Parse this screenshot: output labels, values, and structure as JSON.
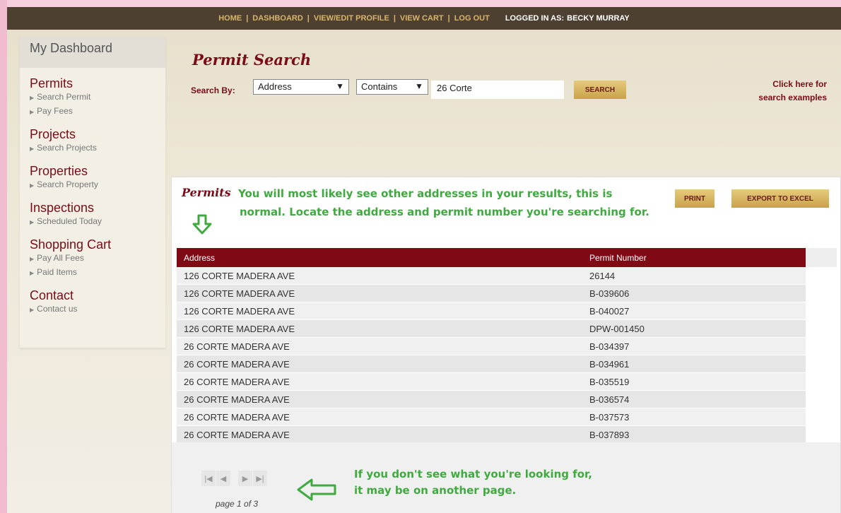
{
  "topnav": {
    "items": [
      "HOME",
      "DASHBOARD",
      "VIEW/EDIT PROFILE",
      "VIEW CART",
      "LOG OUT"
    ],
    "separator": "|",
    "logged_in_label": "LOGGED IN AS:",
    "user": "BECKY MURRAY"
  },
  "sidebar": {
    "heading": "My Dashboard",
    "sections": [
      {
        "title": "Permits",
        "links": [
          "Search Permit",
          "Pay Fees"
        ]
      },
      {
        "title": "Projects",
        "links": [
          "Search Projects"
        ]
      },
      {
        "title": "Properties",
        "links": [
          "Search Property"
        ]
      },
      {
        "title": "Inspections",
        "links": [
          "Scheduled Today"
        ]
      },
      {
        "title": "Shopping Cart",
        "links": [
          "Pay All Fees",
          "Paid Items"
        ]
      },
      {
        "title": "Contact",
        "links": [
          "Contact us"
        ]
      }
    ]
  },
  "search": {
    "title": "Permit Search",
    "label": "Search By:",
    "field": "Address",
    "operator": "Contains",
    "value": "26 Corte",
    "button": "SEARCH",
    "examples_line1": "Click here for",
    "examples_line2": "search examples"
  },
  "results": {
    "title": "Permits",
    "note_line1": "You will most likely see other addresses in your results, this is",
    "note_line2": "normal. Locate the address and permit number you're searching for.",
    "print_button": "PRINT",
    "export_button": "EXPORT TO EXCEL",
    "columns": [
      "Address",
      "Permit Number"
    ],
    "rows": [
      [
        "126 CORTE MADERA AVE",
        "26144"
      ],
      [
        "126 CORTE MADERA AVE",
        "B-039606"
      ],
      [
        "126 CORTE MADERA AVE",
        "B-040027"
      ],
      [
        "126 CORTE MADERA AVE",
        "DPW-001450"
      ],
      [
        "26 CORTE MADERA AVE",
        "B-034397"
      ],
      [
        "26 CORTE MADERA AVE",
        "B-034961"
      ],
      [
        "26 CORTE MADERA AVE",
        "B-035519"
      ],
      [
        "26 CORTE MADERA AVE",
        "B-036574"
      ],
      [
        "26 CORTE MADERA AVE",
        "B-037573"
      ],
      [
        "26 CORTE MADERA AVE",
        "B-037893"
      ]
    ],
    "pager_glyphs": [
      "|◀",
      "◀",
      "▶",
      "▶|"
    ],
    "page_info": "page 1 of 3",
    "hint_line1": "If you don't see what you're looking for,",
    "hint_line2": "it may be on another page."
  },
  "colors": {
    "brand": "#7a0c17",
    "nav_bg": "#4e4030",
    "gold": "#d8b46a",
    "annotation": "#3faa3f"
  }
}
